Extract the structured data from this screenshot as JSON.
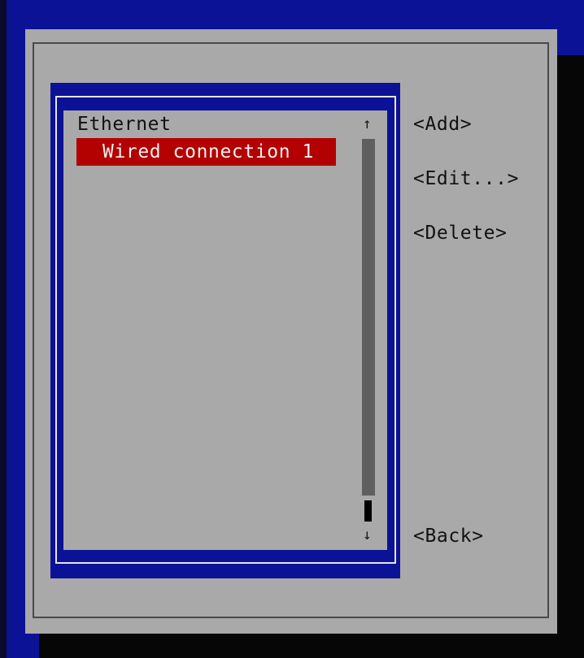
{
  "connections": {
    "group_label": "Ethernet",
    "items": [
      {
        "label": "Wired connection 1",
        "selected": true
      }
    ]
  },
  "scrollbar": {
    "up_arrow": "↑",
    "down_arrow": "↓"
  },
  "buttons": {
    "add": "<Add>",
    "edit": "<Edit...>",
    "delete": "<Delete>",
    "back": "<Back>"
  },
  "colors": {
    "background": "#0c1296",
    "dialog": "#a9a9a9",
    "selection": "#b30000",
    "selection_text": "#f0f0f0"
  }
}
